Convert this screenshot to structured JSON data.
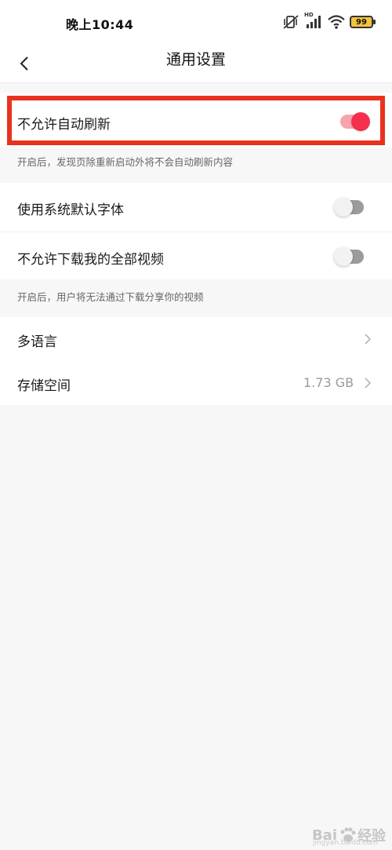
{
  "status_bar": {
    "time": "晚上10:44",
    "battery": "99",
    "signal_label": "HD",
    "icons": [
      "mute-vibrate-icon",
      "signal-icon",
      "wifi-icon",
      "battery-icon"
    ]
  },
  "nav": {
    "title": "通用设置",
    "back_icon": "chevron-left-icon"
  },
  "settings": {
    "auto_refresh": {
      "label": "不允许自动刷新",
      "enabled": true,
      "hint": "开启后，发现页除重新启动外将不会自动刷新内容"
    },
    "system_font": {
      "label": "使用系统默认字体",
      "enabled": false
    },
    "download_videos": {
      "label": "不允许下载我的全部视频",
      "enabled": false,
      "hint": "开启后，用户将无法通过下载分享你的视频"
    },
    "language": {
      "label": "多语言"
    },
    "storage": {
      "label": "存储空间",
      "value": "1.73 GB"
    }
  },
  "watermark": {
    "text": "Bai",
    "text2": "经验",
    "sub": "jingyan.baidu.com"
  },
  "colors": {
    "accent": "#f4304d",
    "highlight": "#e8321e",
    "background": "#f7f7f7"
  }
}
